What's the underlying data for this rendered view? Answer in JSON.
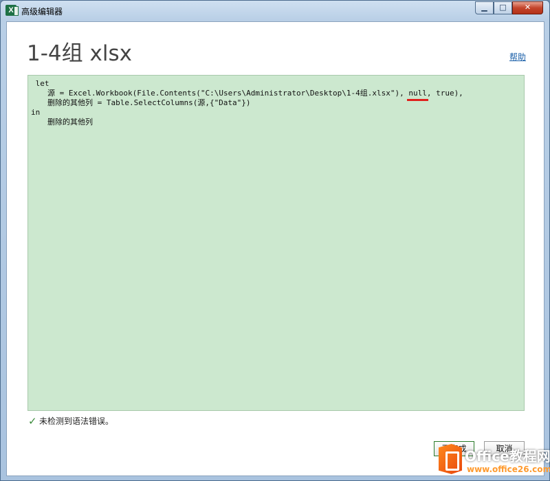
{
  "window": {
    "title": "高级编辑器",
    "app_icon_letter": "X",
    "controls": {
      "minimize": "▁",
      "maximize": "□",
      "close": "✕"
    }
  },
  "header": {
    "title": "1-4组 xlsx",
    "help_link": "帮助"
  },
  "editor": {
    "background_color": "#cce8cf",
    "lines": [
      {
        "indent": 0,
        "text": " let"
      },
      {
        "indent": 1,
        "text_before": "源 = Excel.Workbook(File.Contents(\"C:\\Users\\Administrator\\Desktop\\1-4组.xlsx\"), ",
        "highlight": "null",
        "text_after": ", true),"
      },
      {
        "indent": 1,
        "text": "删除的其他列 = Table.SelectColumns(源,{\"Data\"})"
      },
      {
        "indent": 0,
        "text": "in"
      },
      {
        "indent": 1,
        "text": "删除的其他列"
      }
    ]
  },
  "status": {
    "icon": "check-icon",
    "text": "未检测到语法错误。"
  },
  "buttons": {
    "done": "已完成",
    "cancel": "取消"
  },
  "watermark": {
    "main": "Office教程网",
    "sub": "www.office26.com"
  },
  "colors": {
    "accent_underline": "#e0201c",
    "check_green": "#3a8a3a",
    "link_blue": "#1a5fa8"
  }
}
